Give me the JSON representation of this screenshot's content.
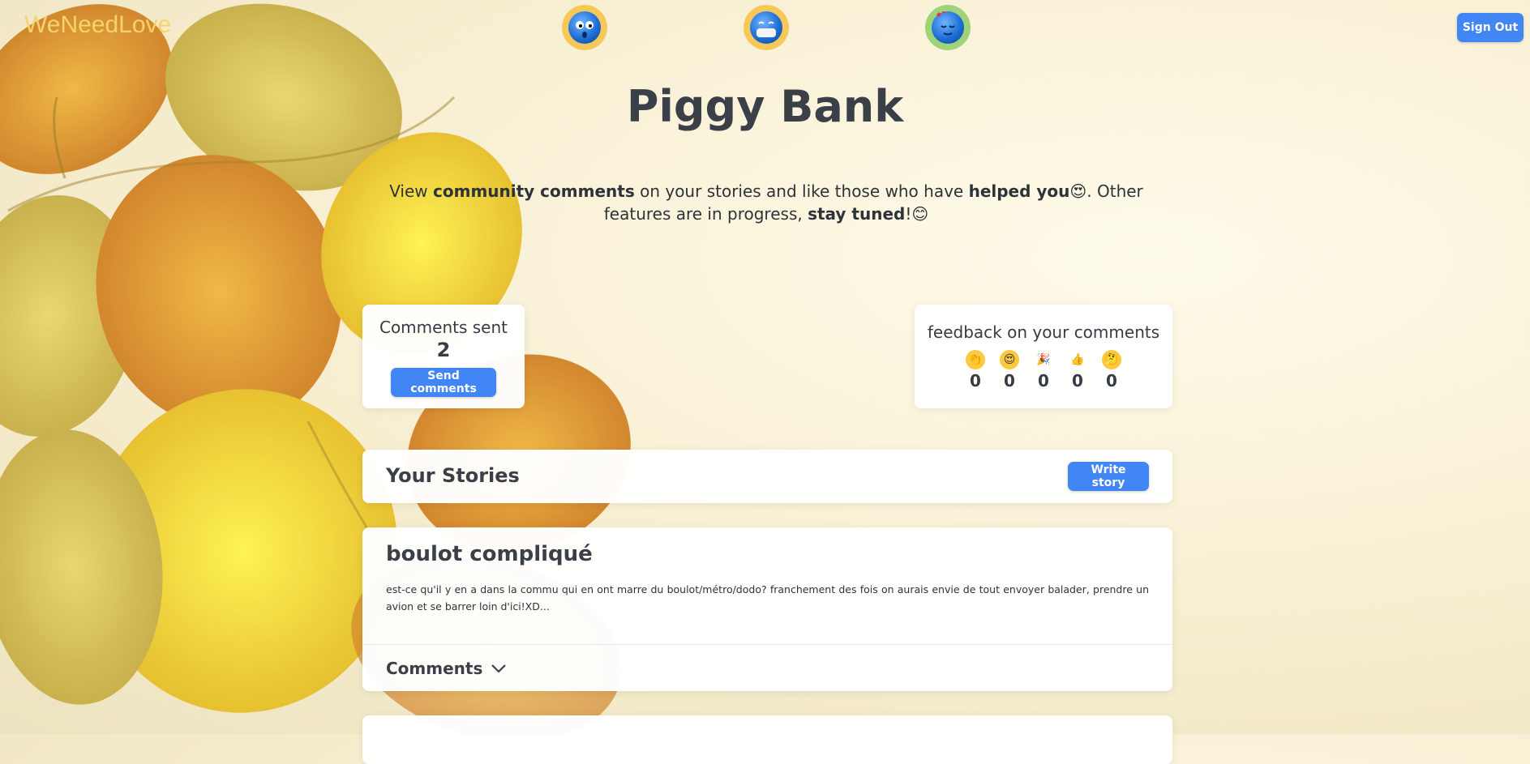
{
  "brand": "WeNeedLove",
  "header": {
    "signout_label": "Sign Out"
  },
  "page": {
    "title": "Piggy Bank",
    "intro": {
      "p1": "View ",
      "b1": "community comments",
      "p2": " on your stories and like those who have ",
      "b2": "helped you",
      "e1": "😍",
      "p3": ". Other features are in progress, ",
      "b3": "stay tuned",
      "p4": "!",
      "e2": "😊"
    }
  },
  "comments_sent": {
    "label": "Comments sent",
    "count": "2",
    "button": "Send comments"
  },
  "feedback": {
    "label": "feedback on your comments",
    "items": [
      {
        "icon": "👏",
        "icon_name": "clapping-hands-icon",
        "count": "0"
      },
      {
        "icon": "😍",
        "icon_name": "heart-eyes-icon",
        "count": "0"
      },
      {
        "icon": "🎉",
        "icon_name": "party-popper-icon",
        "count": "0"
      },
      {
        "icon": "👍",
        "icon_name": "thumbs-up-icon",
        "count": "0"
      },
      {
        "icon": "🤔",
        "icon_name": "thinking-face-icon",
        "count": "0"
      }
    ]
  },
  "stories": {
    "heading": "Your Stories",
    "write_button": "Write story",
    "items": [
      {
        "title": "boulot compliqué",
        "excerpt": "est-ce qu'il y en a dans la commu qui en ont marre du boulot/métro/dodo? franchement des fois on aurais envie de tout envoyer balader, prendre un avion et se barrer loin d'ici!XD...",
        "comments_label": "Comments"
      }
    ]
  },
  "colors": {
    "accent": "#4285f4",
    "brand": "#f5d36d",
    "text": "#363b44"
  }
}
